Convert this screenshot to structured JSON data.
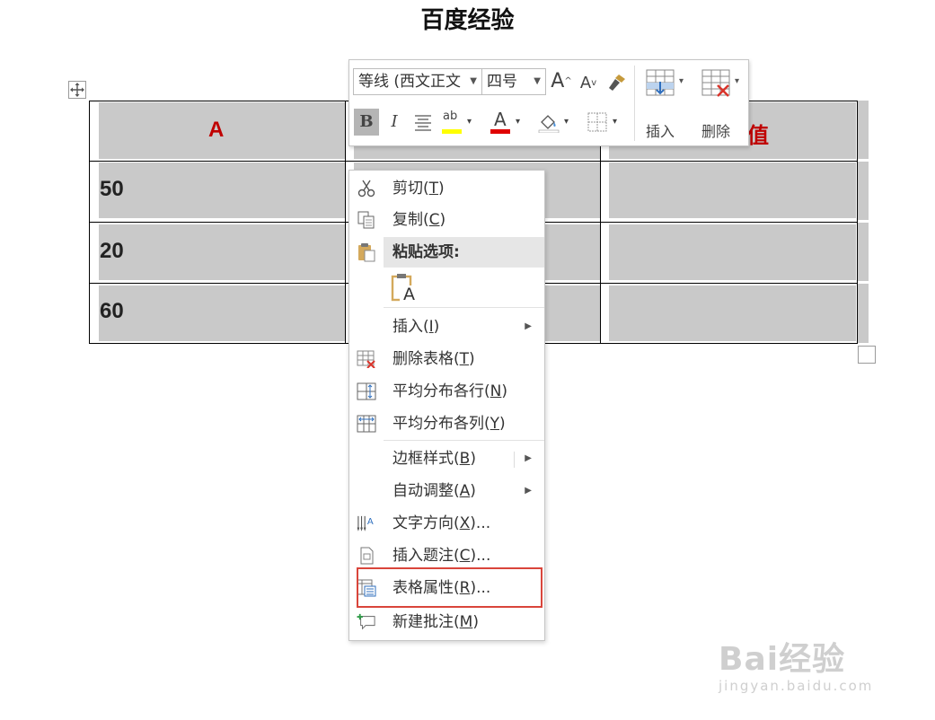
{
  "page": {
    "title": "百度经验"
  },
  "table": {
    "header": [
      "A",
      "",
      "值"
    ],
    "rows": [
      [
        "50",
        "",
        ""
      ],
      [
        "20",
        "",
        ""
      ],
      [
        "60",
        "",
        ""
      ]
    ]
  },
  "mini_toolbar": {
    "font_name": "等线 (西文正文",
    "font_size": "四号",
    "grow_font": "A",
    "shrink_font": "A",
    "bold": "B",
    "italic": "I",
    "font_color_glyph": "A",
    "highlight_glyph": "ab",
    "insert_label": "插入",
    "delete_label": "删除"
  },
  "context_menu": {
    "cut": {
      "text": "剪切(",
      "key": "T",
      "tail": ")"
    },
    "copy": {
      "text": "复制(",
      "key": "C",
      "tail": ")"
    },
    "paste_options": "粘贴选项:",
    "paste_glyph": "A",
    "insert": {
      "text": "插入(",
      "key": "I",
      "tail": ")"
    },
    "delete_table": {
      "text": "删除表格(",
      "key": "T",
      "tail": ")"
    },
    "distribute_rows": {
      "text": "平均分布各行(",
      "key": "N",
      "tail": ")"
    },
    "distribute_cols": {
      "text": "平均分布各列(",
      "key": "Y",
      "tail": ")"
    },
    "border_styles": {
      "text": "边框样式(",
      "key": "B",
      "tail": ")"
    },
    "autofit": {
      "text": "自动调整(",
      "key": "A",
      "tail": ")"
    },
    "text_direction": {
      "text": "文字方向(",
      "key": "X",
      "tail": ")..."
    },
    "insert_caption": {
      "text": "插入题注(",
      "key": "C",
      "tail": ")..."
    },
    "table_properties": {
      "text": "表格属性(",
      "key": "R",
      "tail": ")..."
    },
    "new_comment": {
      "text": "新建批注(",
      "key": "M",
      "tail": ")"
    }
  },
  "colors": {
    "header_text": "#c00000",
    "cell_fill": "#c9c9c9",
    "highlight_border": "#d9453b",
    "font_color_bar": "#e00000",
    "highlight_bar": "#ffff00"
  },
  "watermark": {
    "logo": "Bai经验",
    "url": "jingyan.baidu.com"
  }
}
